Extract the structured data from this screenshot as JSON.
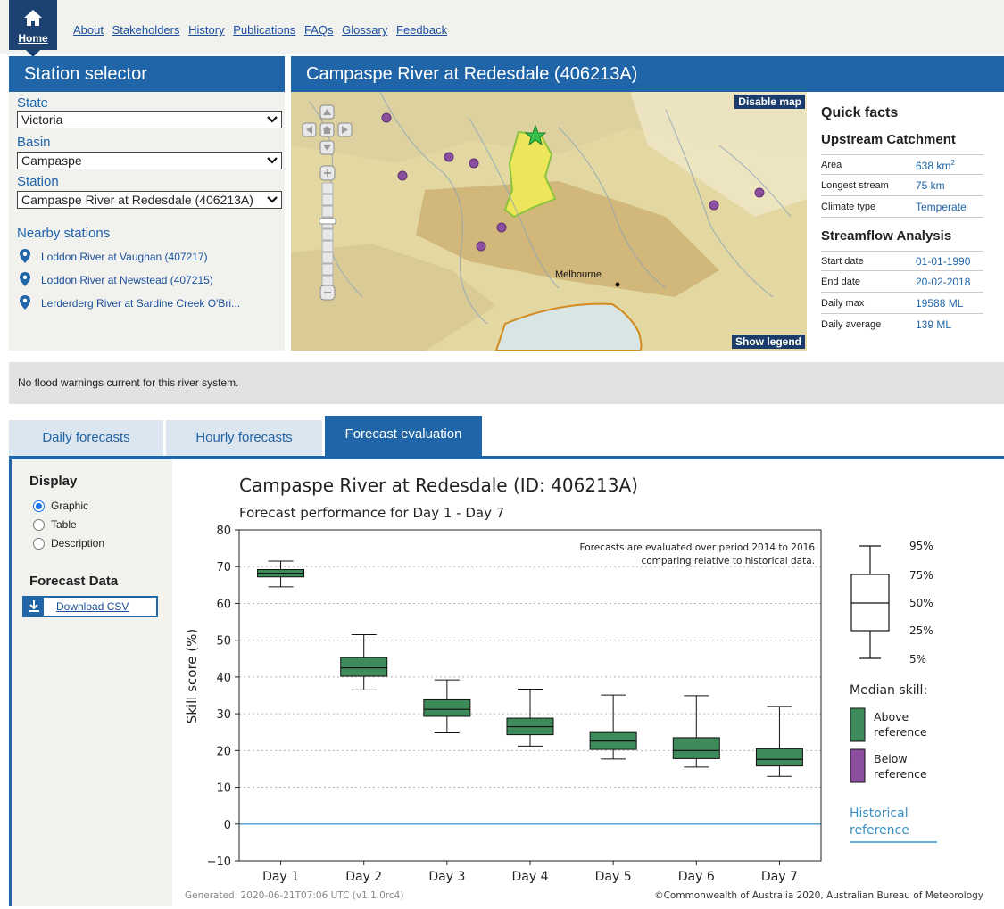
{
  "nav": {
    "home_label": "Home",
    "links": [
      "About",
      "Stakeholders",
      "History",
      "Publications",
      "FAQs",
      "Glossary",
      "Feedback"
    ]
  },
  "selector": {
    "title": "Station selector",
    "state_label": "State",
    "state_value": "Victoria",
    "basin_label": "Basin",
    "basin_value": "Campaspe",
    "station_label": "Station",
    "station_value": "Campaspe River at Redesdale (406213A)",
    "nearby_title": "Nearby stations",
    "nearby": [
      "Loddon River at Vaughan (407217)",
      "Loddon River at Newstead (407215)",
      "Lerderderg River at Sardine Creek O'Bri..."
    ]
  },
  "map": {
    "title": "Campaspe River at Redesdale (406213A)",
    "disable_label": "Disable map",
    "legend_label": "Show legend",
    "city_label": "Melbourne"
  },
  "facts": {
    "title": "Quick facts",
    "catchment_title": "Upstream Catchment",
    "area_label": "Area",
    "area_value": "638 km",
    "area_sup": "2",
    "stream_label": "Longest stream",
    "stream_value": "75 km",
    "climate_label": "Climate type",
    "climate_value": "Temperate",
    "analysis_title": "Streamflow Analysis",
    "start_label": "Start date",
    "start_value": "01-01-1990",
    "end_label": "End date",
    "end_value": "20-02-2018",
    "max_label": "Daily max",
    "max_value": "19588 ML",
    "avg_label": "Daily average",
    "avg_value": "139 ML"
  },
  "flood_message": "No flood warnings current for this river system.",
  "tabs": [
    "Daily forecasts",
    "Hourly forecasts",
    "Forecast evaluation"
  ],
  "display": {
    "title": "Display",
    "options": [
      "Graphic",
      "Table",
      "Description"
    ],
    "selected": "Graphic",
    "data_title": "Forecast Data",
    "download_label": "Download CSV"
  },
  "colors": {
    "above": "#3d8a5a",
    "below": "#8c4f9f",
    "reference": "#6aaed6",
    "brand": "#1f65a8"
  },
  "chart_data": {
    "type": "box",
    "title": "Campaspe River at Redesdale (ID: 406213A)",
    "subtitle": "Forecast performance for Day 1 - Day 7",
    "ylabel": "Skill score (%)",
    "xlabel": "",
    "ylim": [
      -10,
      80
    ],
    "yticks": [
      80,
      70,
      60,
      50,
      40,
      30,
      20,
      10,
      0,
      -10
    ],
    "grid": true,
    "annotation": [
      "Forecasts are evaluated over period 2014 to 2016",
      "comparing relative to historical data."
    ],
    "categories": [
      "Day 1",
      "Day 2",
      "Day 3",
      "Day 4",
      "Day 5",
      "Day 6",
      "Day 7"
    ],
    "boxes": [
      {
        "p5": 64.5,
        "p25": 67.2,
        "p50": 68.2,
        "p75": 69.2,
        "p95": 71.5,
        "median_skill": "above"
      },
      {
        "p5": 36.5,
        "p25": 40.2,
        "p50": 42.5,
        "p75": 45.3,
        "p95": 51.5,
        "median_skill": "above"
      },
      {
        "p5": 24.8,
        "p25": 29.3,
        "p50": 31.2,
        "p75": 33.8,
        "p95": 39.2,
        "median_skill": "above"
      },
      {
        "p5": 21.2,
        "p25": 24.3,
        "p50": 26.5,
        "p75": 28.8,
        "p95": 36.7,
        "median_skill": "above"
      },
      {
        "p5": 17.7,
        "p25": 20.3,
        "p50": 22.6,
        "p75": 24.9,
        "p95": 35.1,
        "median_skill": "above"
      },
      {
        "p5": 15.5,
        "p25": 17.8,
        "p50": 20.0,
        "p75": 23.5,
        "p95": 34.9,
        "median_skill": "above"
      },
      {
        "p5": 13.0,
        "p25": 15.8,
        "p50": 17.6,
        "p75": 20.5,
        "p95": 32.0,
        "median_skill": "above"
      }
    ],
    "reference_value": 0,
    "legend": {
      "percentiles": [
        "95%",
        "75%",
        "50%",
        "25%",
        "5%"
      ],
      "median_skill_title": "Median skill:",
      "above_label": [
        "Above",
        "reference"
      ],
      "below_label": [
        "Below",
        "reference"
      ],
      "reference_label": [
        "Historical",
        "reference"
      ]
    },
    "footer_left": "Generated: 2020-06-21T07:06 UTC (v1.1.0rc4)",
    "footer_right": "©Commonwealth of Australia 2020, Australian Bureau of Meteorology"
  }
}
